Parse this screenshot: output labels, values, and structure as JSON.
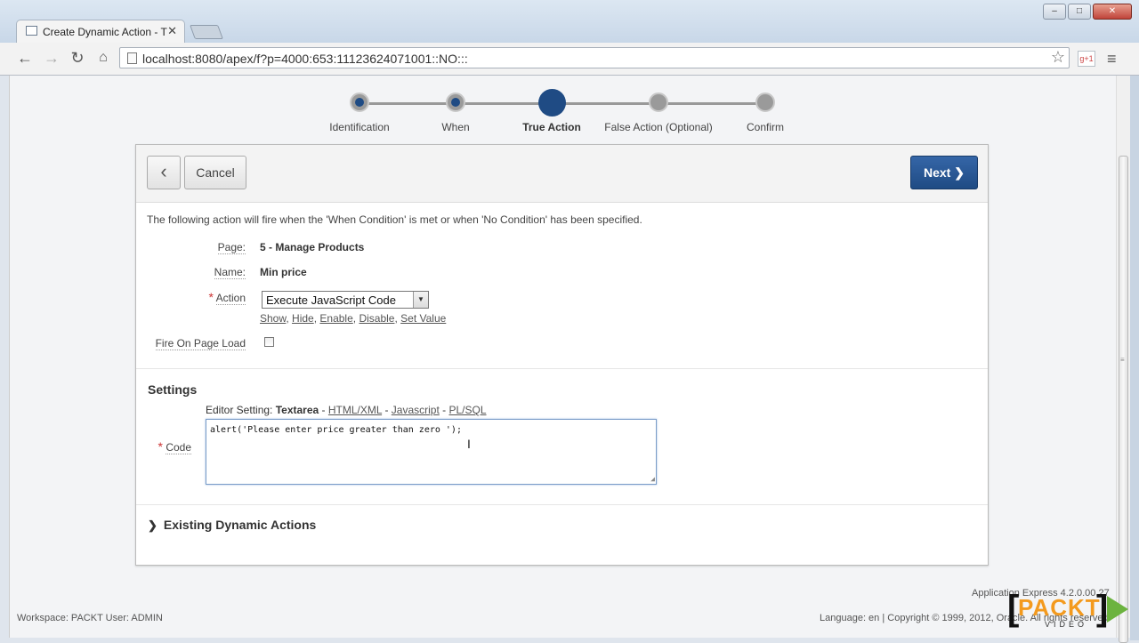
{
  "browser": {
    "tab_title": "Create Dynamic Action - T",
    "url": "localhost:8080/apex/f?p=4000:653:11123624071001::NO:::",
    "window_buttons": [
      "–",
      "□",
      "✕"
    ]
  },
  "wizard": {
    "steps": [
      {
        "label": "Identification",
        "state": "done"
      },
      {
        "label": "When",
        "state": "done"
      },
      {
        "label": "True Action",
        "state": "current"
      },
      {
        "label": "False Action (Optional)",
        "state": "pending"
      },
      {
        "label": "Confirm",
        "state": "pending"
      }
    ]
  },
  "buttons": {
    "back": "‹",
    "cancel": "Cancel",
    "next": "Next"
  },
  "form": {
    "intro": "The following action will fire when the 'When Condition' is met or when 'No Condition' has been specified.",
    "page_label": "Page:",
    "page_value": "5 - Manage Products",
    "name_label": "Name:",
    "name_value": "Min price",
    "action_label": "Action",
    "action_value": "Execute JavaScript Code",
    "quick_picks": [
      "Show",
      "Hide",
      "Enable",
      "Disable",
      "Set Value"
    ],
    "fire_on_load_label": "Fire On Page Load",
    "fire_on_load_checked": false
  },
  "settings": {
    "heading": "Settings",
    "editor_prefix": "Editor Setting:",
    "editor_current": "Textarea",
    "editor_options": [
      "HTML/XML",
      "Javascript",
      "PL/SQL"
    ],
    "code_label": "Code",
    "code_value": "alert('Please enter price greater than zero ');"
  },
  "existing": {
    "label": "Existing Dynamic Actions"
  },
  "footer": {
    "version": "Application Express 4.2.0.00.27",
    "workspace": "Workspace: PACKT User: ADMIN",
    "language_copyright": "Language: en | Copyright © 1999, 2012, Oracle. All rights reserved."
  },
  "watermark": {
    "word": "PACKT",
    "sub": "VIDEO"
  },
  "colors": {
    "accent": "#1f4b84",
    "required": "#cc3333"
  }
}
